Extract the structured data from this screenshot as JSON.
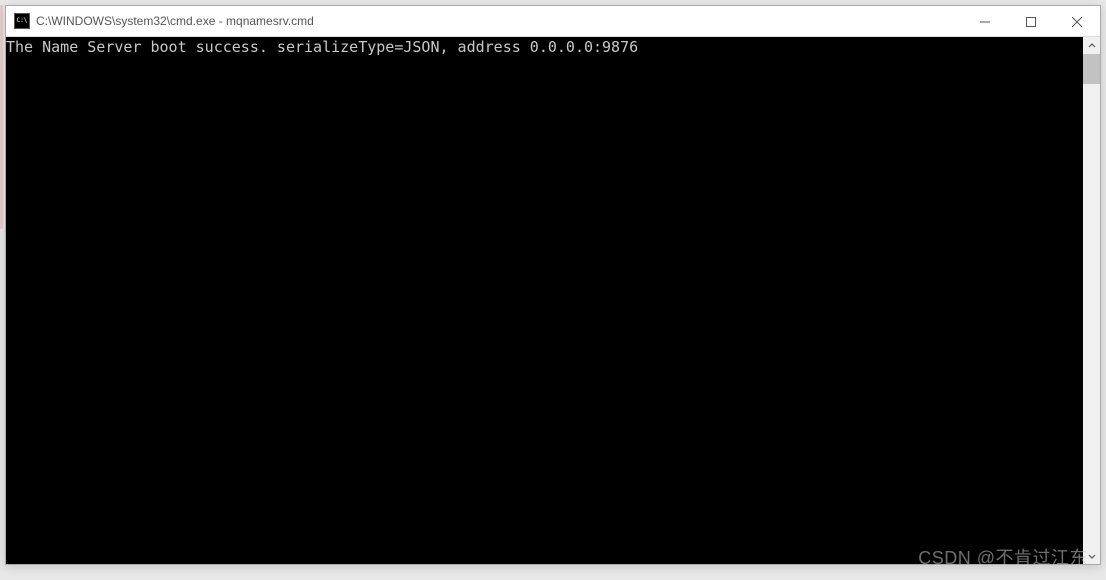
{
  "window": {
    "title": "C:\\WINDOWS\\system32\\cmd.exe - mqnamesrv.cmd"
  },
  "terminal": {
    "output": "The Name Server boot success. serializeType=JSON, address 0.0.0.0:9876"
  },
  "watermark": {
    "text": "CSDN @不肯过江东"
  }
}
